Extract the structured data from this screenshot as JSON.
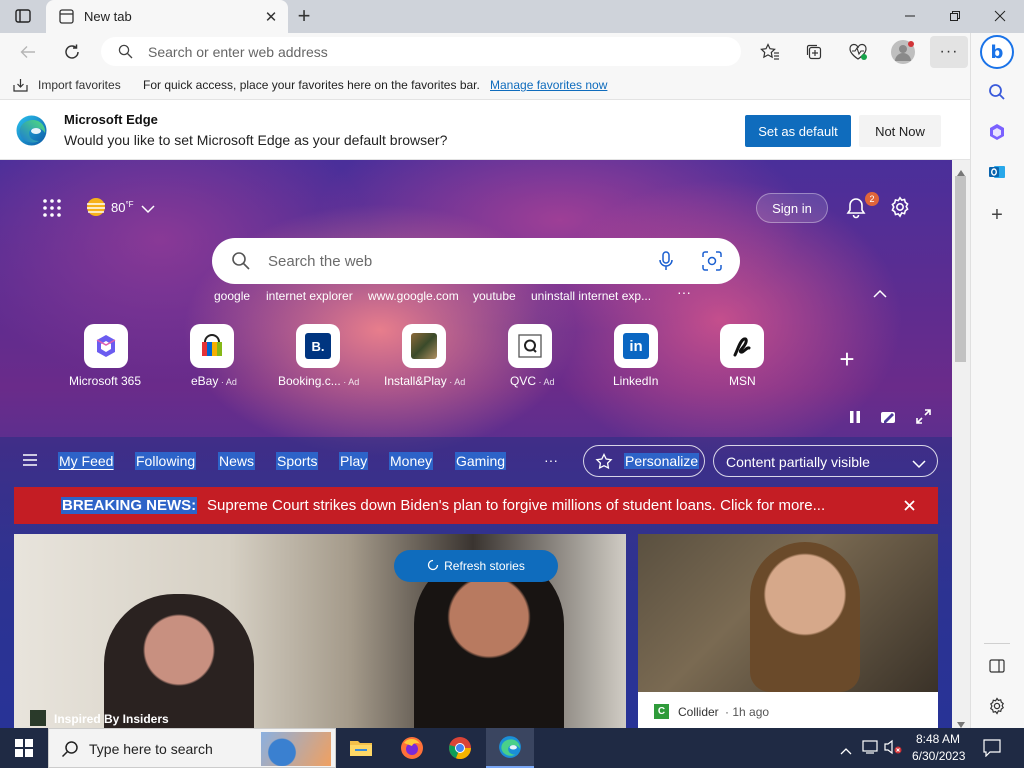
{
  "tab": {
    "title": "New tab"
  },
  "address": {
    "placeholder": "Search or enter web address"
  },
  "favorites_bar": {
    "import_label": "Import favorites",
    "message": "For quick access, place your favorites here on the favorites bar.",
    "manage_link": "Manage favorites now"
  },
  "infobar": {
    "title": "Microsoft Edge",
    "message": "Would you like to set Microsoft Edge as your default browser?",
    "set_default": "Set as default",
    "not_now": "Not Now"
  },
  "weather": {
    "temp": "80",
    "unit": "°F"
  },
  "header": {
    "sign_in": "Sign in",
    "notification_count": "2"
  },
  "search": {
    "placeholder": "Search the web"
  },
  "quick_links": [
    "google",
    "internet explorer",
    "www.google.com",
    "youtube",
    "uninstall internet exp..."
  ],
  "tiles": [
    {
      "label": "Microsoft 365",
      "ad": ""
    },
    {
      "label": "eBay",
      "ad": "Ad"
    },
    {
      "label": "Booking.c...",
      "ad": "Ad"
    },
    {
      "label": "Install&Play",
      "ad": "Ad"
    },
    {
      "label": "QVC",
      "ad": "Ad"
    },
    {
      "label": "LinkedIn",
      "ad": ""
    },
    {
      "label": "MSN",
      "ad": ""
    }
  ],
  "feed_nav": {
    "items": [
      "My Feed",
      "Following",
      "News",
      "Sports",
      "Play",
      "Money",
      "Gaming"
    ],
    "more": "···",
    "personalize": "Personalize",
    "content_visibility": "Content partially visible"
  },
  "breaking": {
    "label": "BREAKING NEWS:",
    "text": "Supreme Court strikes down Biden's plan to forgive millions of student loans. Click for more..."
  },
  "refresh": {
    "label": "Refresh stories"
  },
  "cards": [
    {
      "source": "Inspired By Insiders",
      "time": ""
    },
    {
      "source": "Collider",
      "time": "1h ago"
    }
  ],
  "taskbar": {
    "search_placeholder": "Type here to search",
    "time": "8:48 AM",
    "date": "6/30/2023"
  },
  "colors": {
    "accent": "#0f6cbd",
    "breaking_red": "#c41d24",
    "highlight": "#2d63c8"
  }
}
